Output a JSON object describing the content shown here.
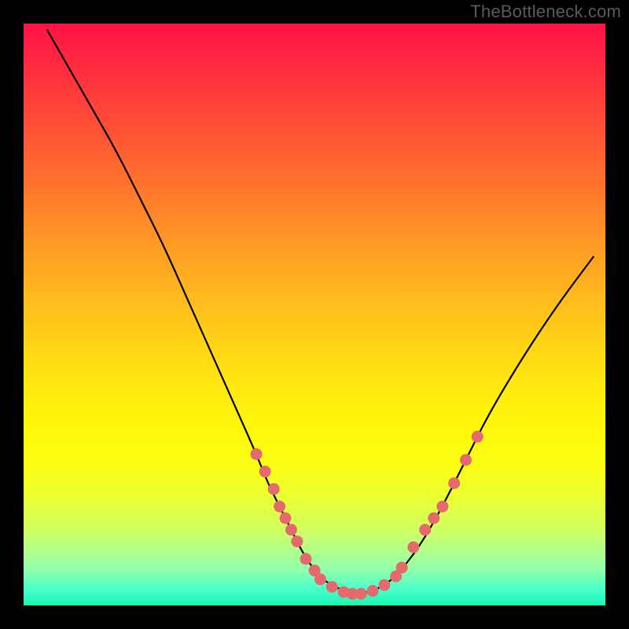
{
  "watermark": "TheBottleneck.com",
  "chart_data": {
    "type": "line",
    "title": "",
    "xlabel": "",
    "ylabel": "",
    "xlim": [
      0,
      100
    ],
    "ylim": [
      0,
      100
    ],
    "curve": {
      "x": [
        4,
        8,
        12,
        16,
        20,
        24,
        28,
        32,
        36,
        40,
        42,
        44,
        46,
        48,
        50,
        52,
        54,
        56,
        58,
        60,
        62,
        64,
        68,
        72,
        76,
        80,
        86,
        92,
        98
      ],
      "y": [
        99,
        92,
        85,
        78,
        70,
        62,
        53,
        44,
        35,
        26,
        21,
        17,
        13,
        9,
        6,
        4,
        3,
        2,
        2,
        2.5,
        3.5,
        5,
        10,
        17,
        25,
        33,
        43,
        52,
        60
      ]
    },
    "markers_left": {
      "x": [
        40,
        41.5,
        43,
        44,
        45,
        46,
        47,
        48.5,
        50
      ],
      "y": [
        26,
        23,
        20,
        17,
        15,
        13,
        11,
        8,
        6
      ]
    },
    "markers_bottom": {
      "x": [
        51,
        53,
        55,
        56.5,
        58,
        60,
        62,
        64
      ],
      "y": [
        4.5,
        3.2,
        2.3,
        2.0,
        2.0,
        2.5,
        3.5,
        5.0
      ]
    },
    "markers_right": {
      "x": [
        65,
        67,
        69,
        70.5,
        72,
        74,
        76,
        78
      ],
      "y": [
        6.5,
        10,
        13,
        15,
        17,
        21,
        25,
        29
      ]
    },
    "colors": {
      "curve": "#000000",
      "marker": "#e46a6d",
      "gradient_top": "#ff1245",
      "gradient_bottom": "#18f7b5",
      "background": "#000000"
    }
  }
}
